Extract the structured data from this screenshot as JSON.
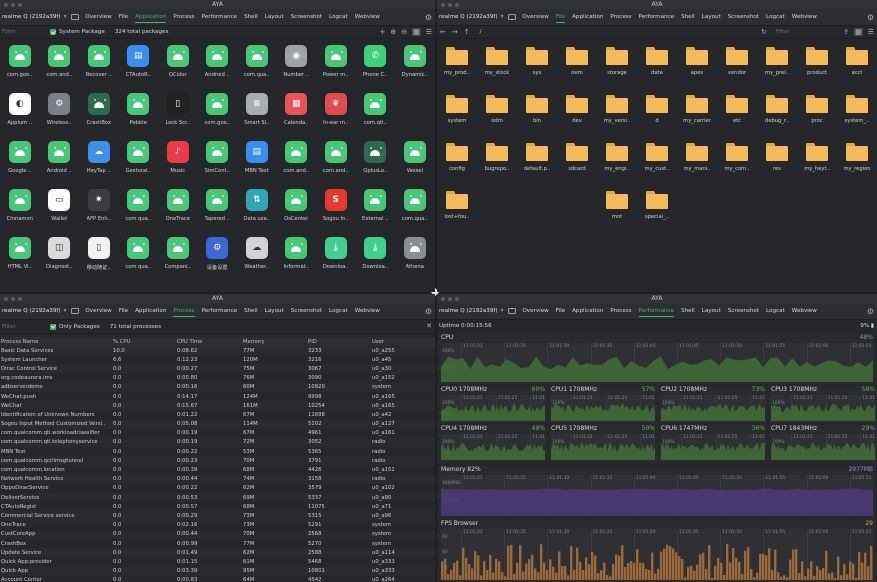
{
  "app_title": "AYA",
  "device": "realme Q (2192a39f)",
  "tabs": [
    "Overview",
    "File",
    "Application",
    "Process",
    "Performance",
    "Shell",
    "Layout",
    "Screenshot",
    "Logcat",
    "Webview"
  ],
  "apps": {
    "filter_placeholder": "Filter",
    "system_package_label": "System Package",
    "count": "324 total packages",
    "items": [
      {
        "label": "com.goo..",
        "icon": "android"
      },
      {
        "label": "com.and..",
        "icon": "android"
      },
      {
        "label": "Recover ..",
        "icon": "android"
      },
      {
        "label": "CTAutoR..",
        "icon": "document"
      },
      {
        "label": "QColor",
        "icon": "android"
      },
      {
        "label": "Android ..",
        "icon": "android"
      },
      {
        "label": "com.qua..",
        "icon": "android"
      },
      {
        "label": "Number ..",
        "icon": "location"
      },
      {
        "label": "Power m..",
        "icon": "android"
      },
      {
        "label": "Phone C..",
        "icon": "phone"
      },
      {
        "label": "Dynamic..",
        "icon": "android"
      },
      {
        "label": "Appium ..",
        "icon": "appium"
      },
      {
        "label": "Wireless..",
        "icon": "gear"
      },
      {
        "label": "CrashBox",
        "icon": "android-dark"
      },
      {
        "label": "Pebble",
        "icon": "android"
      },
      {
        "label": "Lock Scr..",
        "icon": "lock"
      },
      {
        "label": "com.goo..",
        "icon": "android"
      },
      {
        "label": "Smart Si..",
        "icon": "menu"
      },
      {
        "label": "Calenda..",
        "icon": "calendar"
      },
      {
        "label": "In-ear m..",
        "icon": "earbuds"
      },
      {
        "label": "com.qti..",
        "icon": "android"
      },
      {
        "label": "",
        "icon": ""
      },
      {
        "label": "Google ..",
        "icon": "android"
      },
      {
        "label": "Android ..",
        "icon": "android"
      },
      {
        "label": "HeyTap ..",
        "icon": "cloud"
      },
      {
        "label": "Gestural..",
        "icon": "android"
      },
      {
        "label": "Music",
        "icon": "music"
      },
      {
        "label": "SimCont..",
        "icon": "android"
      },
      {
        "label": "MBN Test",
        "icon": "document"
      },
      {
        "label": "com.and..",
        "icon": "android"
      },
      {
        "label": "com.and..",
        "icon": "android"
      },
      {
        "label": "OplusLo..",
        "icon": "android-dark"
      },
      {
        "label": "Vessel",
        "icon": "android"
      },
      {
        "label": "Cinnamon",
        "icon": "android"
      },
      {
        "label": "Wallet",
        "icon": "wallet"
      },
      {
        "label": "AFP Enh..",
        "icon": "gear-dark"
      },
      {
        "label": "com.qua..",
        "icon": "android"
      },
      {
        "label": "OneTrace",
        "icon": "android"
      },
      {
        "label": "Tapered ..",
        "icon": "android"
      },
      {
        "label": "Data usa..",
        "icon": "data"
      },
      {
        "label": "OsCenter",
        "icon": "android"
      },
      {
        "label": "Sogou In..",
        "icon": "sogou"
      },
      {
        "label": "External ..",
        "icon": "android"
      },
      {
        "label": "com.qua..",
        "icon": "android"
      },
      {
        "label": "HTML Vi..",
        "icon": "android"
      },
      {
        "label": "Diagnost..",
        "icon": "diagnostic"
      },
      {
        "label": "移动随证..",
        "icon": "phone-white"
      },
      {
        "label": "com.qua..",
        "icon": "android"
      },
      {
        "label": "Compani..",
        "icon": "android"
      },
      {
        "label": "设备设置",
        "icon": "gear-blue"
      },
      {
        "label": "Weather..",
        "icon": "weather"
      },
      {
        "label": "Informat..",
        "icon": "android"
      },
      {
        "label": "Downloa..",
        "icon": "download"
      },
      {
        "label": "Downloa..",
        "icon": "download"
      },
      {
        "label": "Athena",
        "icon": "android-grey"
      }
    ]
  },
  "files": {
    "filter_placeholder": "Filter",
    "path": "/",
    "items": [
      "my_prod..",
      "my_stock",
      "sys",
      "oem",
      "storage",
      "data",
      "apex",
      "vendor",
      "my_prel..",
      "product",
      "acct",
      "system",
      "odm",
      "bin",
      "dev",
      "my_versi..",
      "d",
      "my_carrier",
      "etc",
      "debug_r..",
      "proc",
      "system_..",
      "config",
      "bugrepo..",
      "default.p..",
      "sdcard",
      "my_engi..",
      "my_cust..",
      "my_mani..",
      "my_com..",
      "res",
      "my_heyt..",
      "my_region",
      "lost+fou..",
      "",
      "",
      "",
      "mnt",
      "special_.."
    ]
  },
  "processes": {
    "filter_placeholder": "Filter",
    "only_packages_label": "Only Packages",
    "count": "71 total processes",
    "columns": [
      "Process Name",
      "% CPU",
      "CPU Time",
      "Memory",
      "PID",
      "User"
    ],
    "rows": [
      [
        "Basic Data Services",
        "10.0",
        "0:08.62",
        "77M",
        "3233",
        "u0_a255"
      ],
      [
        "System Launcher",
        "6.6",
        "0:12.23",
        "120M",
        "3216",
        "u0_a45"
      ],
      [
        "Dirac Control Service",
        "0.0",
        "0:00.27",
        "75M",
        "3067",
        "u0_a30"
      ],
      [
        "org.codeaurora.ims",
        "0.0",
        "0:00.80",
        "76M",
        "3090",
        "u0_a152"
      ],
      [
        "adbserverdemo",
        "0.0",
        "0:00.16",
        "60M",
        "10920",
        "system"
      ],
      [
        "WeChat:push",
        "0.0",
        "0:14.17",
        "124M",
        "9998",
        "u0_a165"
      ],
      [
        "WeChat",
        "0.0",
        "0:15.67",
        "161M",
        "10254",
        "u0_a165"
      ],
      [
        "Identification of Unknown Numbers",
        "0.0",
        "0:01.22",
        "67M",
        "11698",
        "u0_a42"
      ],
      [
        "Sogou Input Method Customized Versi..",
        "0.0",
        "0:05.08",
        "114M",
        "5102",
        "u0_a127"
      ],
      [
        "com.qualcomm.qti.workloadclassifier",
        "0.0",
        "0:00.19",
        "67M",
        "4961",
        "u0_a161"
      ],
      [
        "com.qualcomm.qti.telephonyservice",
        "0.0",
        "0:00.19",
        "72M",
        "3052",
        "radio"
      ],
      [
        "MBN Test",
        "0.0",
        "0:00.22",
        "53M",
        "5365",
        "radio"
      ],
      [
        "com.qualcomm.qcrilmsgtunnel",
        "0.0",
        "0:00.23",
        "70M",
        "3791",
        "radio"
      ],
      [
        "com.qualcomm.location",
        "0.0",
        "0:00.39",
        "68M",
        "4426",
        "u0_a151"
      ],
      [
        "Network Health Service",
        "0.0",
        "0:00.44",
        "74M",
        "3158",
        "radio"
      ],
      [
        "OppoDiracService",
        "0.0",
        "0:00.22",
        "62M",
        "3579",
        "u0_a102"
      ],
      [
        "DeliverService",
        "0.0",
        "0:00.53",
        "69M",
        "5337",
        "u0_a90"
      ],
      [
        "CTAutoRegist",
        "0.0",
        "0:00.57",
        "68M",
        "11075",
        "u0_a71"
      ],
      [
        "Commercial Service service",
        "0.0",
        "0:00.29",
        "73M",
        "5315",
        "u0_a96"
      ],
      [
        "OneTrace",
        "0.0",
        "0:02.16",
        "73M",
        "5291",
        "system"
      ],
      [
        "CustCoreApp",
        "0.0",
        "0:00.44",
        "70M",
        "2568",
        "system"
      ],
      [
        "CrashBox",
        "0.0",
        "0:00.99",
        "77M",
        "5270",
        "system"
      ],
      [
        "Update Service",
        "0.0",
        "0:01.49",
        "62M",
        "2588",
        "u0_a114"
      ],
      [
        "Quick App:provider",
        "0.0",
        "0:01.15",
        "61M",
        "5468",
        "u0_a333"
      ],
      [
        "Quick App",
        "0.0",
        "0:03.39",
        "95M",
        "10801",
        "u0_a333"
      ],
      [
        "Account Center",
        "0.0",
        "0:00.83",
        "64M",
        "4542",
        "u0_a264"
      ]
    ]
  },
  "performance": {
    "uptime": "Uptime 0:00:15:56",
    "battery": "9%",
    "cpu": {
      "title": "CPU",
      "value": "48%"
    },
    "cores": [
      {
        "title": "CPU0 1708MHz",
        "value": "60%"
      },
      {
        "title": "CPU1 1708MHz",
        "value": "57%"
      },
      {
        "title": "CPU2 1708MHz",
        "value": "73%"
      },
      {
        "title": "CPU3 1708MHz",
        "value": "58%"
      },
      {
        "title": "CPU4 1708MHz",
        "value": "49%"
      },
      {
        "title": "CPU5 1708MHz",
        "value": "50%"
      },
      {
        "title": "CPU6 1747MHz",
        "value": "36%"
      },
      {
        "title": "CPU7 1843MHz",
        "value": "29%"
      }
    ],
    "memory": {
      "title": "Memory 82%",
      "value": "2977MB",
      "y_labels": [
        "4000MB",
        "2000MB"
      ]
    },
    "fps": {
      "title": "FPS Browser",
      "value": "29",
      "y_labels": [
        "60",
        "40",
        "20"
      ]
    },
    "time_ticks": [
      "11:01:21",
      "11:01:25",
      "11:01:30",
      "11:01:35",
      "11:01:40",
      "11:01:45",
      "11:01:50",
      "11:01:55",
      "11:02:00"
    ],
    "pct_ticks": [
      "100%",
      "50%"
    ]
  }
}
